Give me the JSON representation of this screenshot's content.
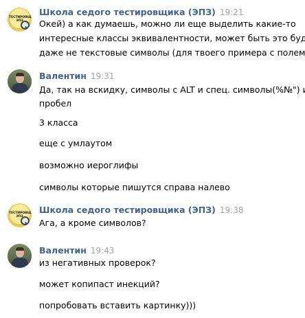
{
  "messages": [
    {
      "author": "Школа седого тестировщика (ЭПЗ)",
      "time": "19:21",
      "avatar_text": "ТЕСТИРОВЩИКА ЭПЗ",
      "lines": [
        "Окей) а как думаешь, можно ли еще выделить какие-то",
        "интересные классы эквивалентности, может быть это будут",
        "даже не текстовые символы (для твоего примера с полем)?"
      ]
    },
    {
      "author": "Валентин",
      "time": "19:31",
      "lines": [
        "Да, так на вскидку, символы с ALT и спец. символы(%№\") и",
        "пробел",
        "3 класса",
        "еще с умлаутом",
        "возможно иероглифы",
        "символы которые пишутся справа налево"
      ]
    },
    {
      "author": "Школа седого тестировщика (ЭПЗ)",
      "time": "19:38",
      "avatar_text": "ТЕСТИРОВЩИКА ЭПЗ",
      "lines": [
        "Ага, а кроме символов?"
      ]
    },
    {
      "author": "Валентин",
      "time": "19:43",
      "lines": [
        "из негативных проверок?",
        "может копипаст инекций?",
        "попробовать вставить картинку)))"
      ]
    }
  ]
}
